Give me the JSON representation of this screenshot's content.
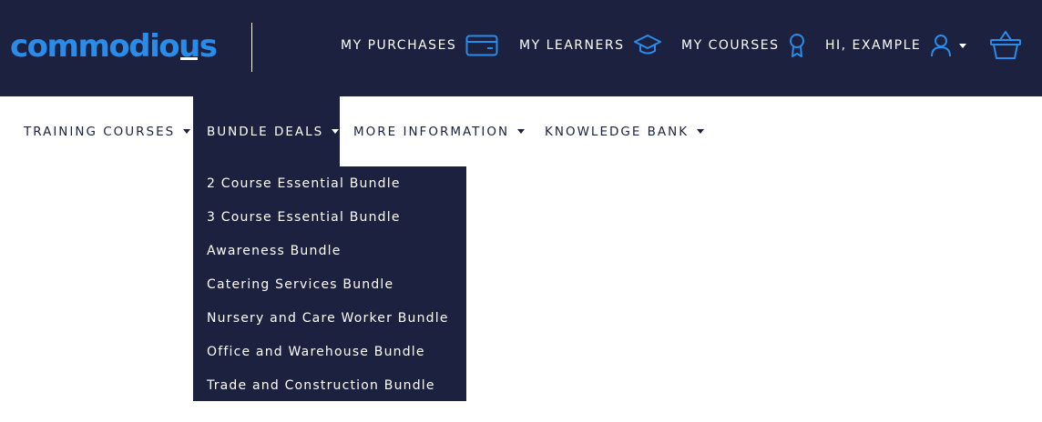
{
  "brand": {
    "logo_prefix": "commodio",
    "logo_u": "u",
    "logo_suffix": "s",
    "logo_color": "#2a8ce8",
    "header_bg": "#1c2140"
  },
  "account_nav": [
    {
      "label": "MY PURCHASES",
      "icon": "credit-card-icon"
    },
    {
      "label": "MY LEARNERS",
      "icon": "graduation-cap-icon"
    },
    {
      "label": "MY COURSES",
      "icon": "award-ribbon-icon"
    },
    {
      "label": "HI, EXAMPLE",
      "icon": "user-icon"
    }
  ],
  "cart": {
    "icon": "basket-icon"
  },
  "main_nav": [
    {
      "label": "TRAINING COURSES",
      "active": false
    },
    {
      "label": "BUNDLE DEALS",
      "active": true
    },
    {
      "label": "MORE INFORMATION",
      "active": false
    },
    {
      "label": "KNOWLEDGE BANK",
      "active": false
    }
  ],
  "bundle_dropdown": [
    "2 Course Essential Bundle",
    "3 Course Essential Bundle",
    "Awareness Bundle",
    "Catering Services Bundle",
    "Nursery and Care Worker Bundle",
    "Office and Warehouse Bundle",
    "Trade and Construction Bundle"
  ]
}
